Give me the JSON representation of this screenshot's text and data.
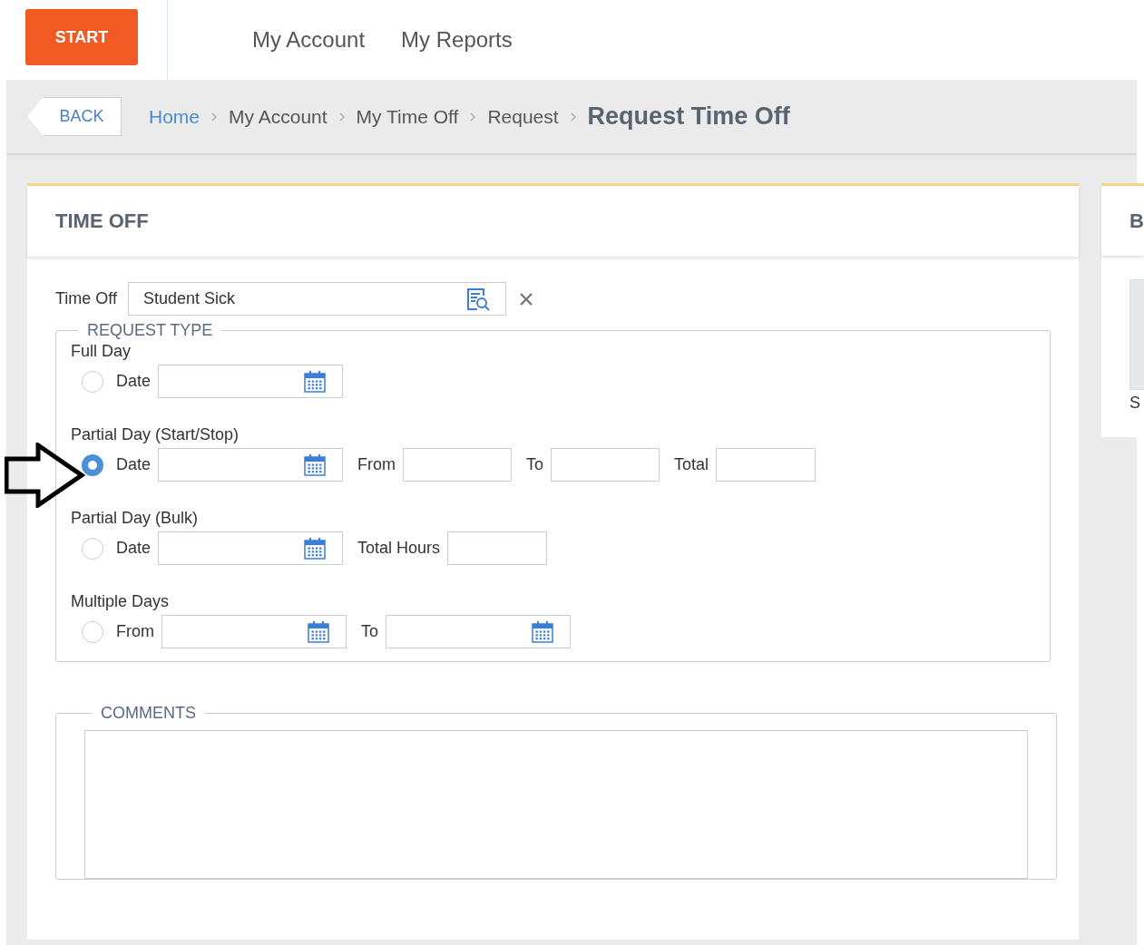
{
  "nav": {
    "start": "START",
    "links": [
      "My Account",
      "My Reports"
    ]
  },
  "breadcrumb": {
    "back": "BACK",
    "items": [
      {
        "label": "Home",
        "link": true
      },
      {
        "label": "My Account",
        "link": false
      },
      {
        "label": "My Time Off",
        "link": false
      },
      {
        "label": "Request",
        "link": false
      }
    ],
    "current": "Request Time Off"
  },
  "card": {
    "title": "TIME OFF",
    "time_off": {
      "label": "Time Off",
      "value": "Student Sick"
    },
    "request_type": {
      "legend": "REQUEST TYPE",
      "options": [
        {
          "title": "Full Day",
          "selected": false,
          "fields": [
            {
              "label": "Date",
              "kind": "date"
            }
          ]
        },
        {
          "title": "Partial Day (Start/Stop)",
          "selected": true,
          "fields": [
            {
              "label": "Date",
              "kind": "date"
            },
            {
              "label": "From",
              "kind": "text"
            },
            {
              "label": "To",
              "kind": "text"
            },
            {
              "label": "Total",
              "kind": "short"
            }
          ]
        },
        {
          "title": "Partial Day (Bulk)",
          "selected": false,
          "fields": [
            {
              "label": "Date",
              "kind": "date"
            },
            {
              "label": "Total Hours",
              "kind": "short"
            }
          ]
        },
        {
          "title": "Multiple Days",
          "selected": false,
          "fields": [
            {
              "label": "From",
              "kind": "date"
            },
            {
              "label": "To",
              "kind": "date"
            }
          ]
        }
      ]
    },
    "comments": {
      "legend": "COMMENTS"
    }
  },
  "side_card": {
    "title": "B",
    "caption": "S"
  }
}
